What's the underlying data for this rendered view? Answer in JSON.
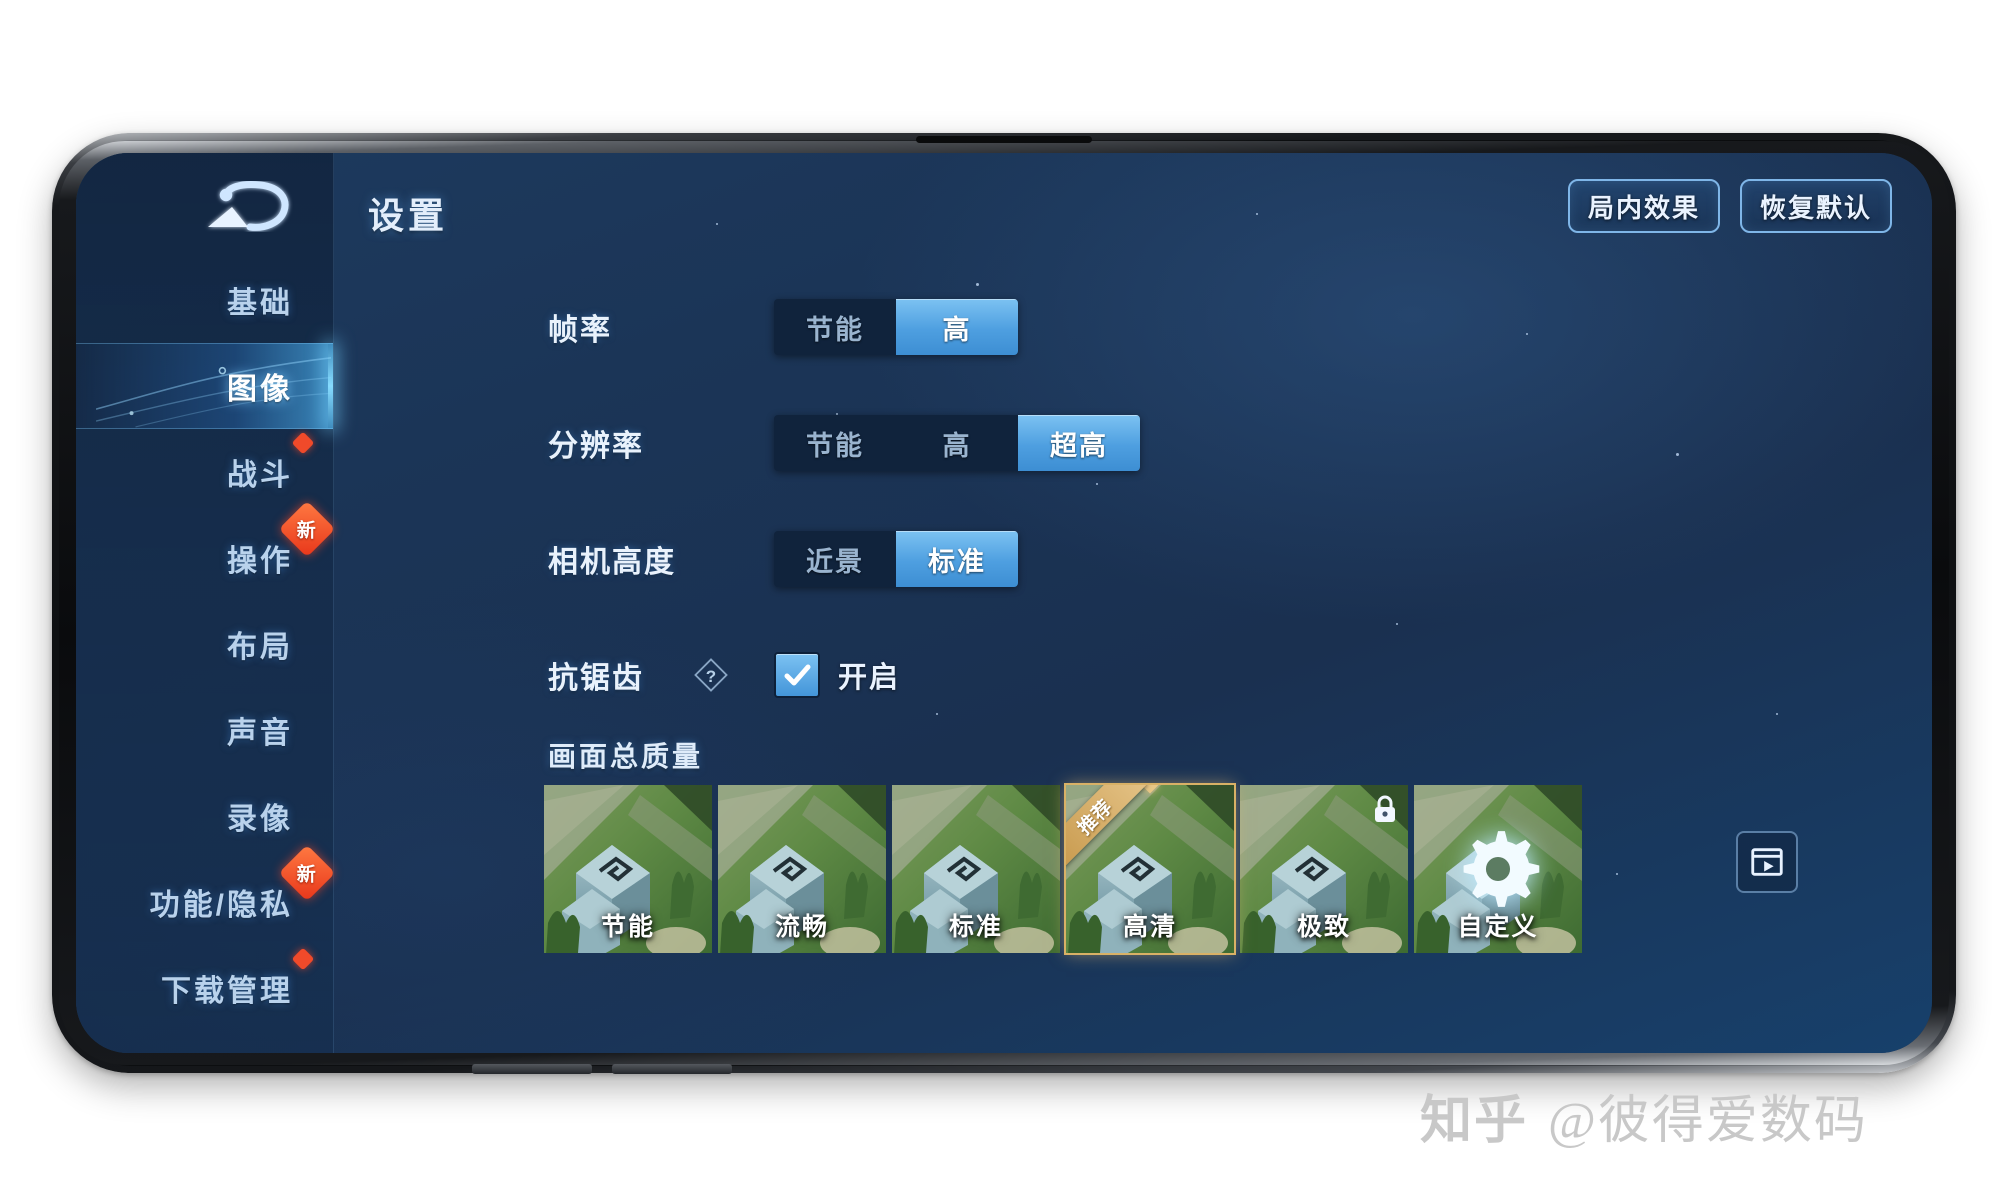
{
  "app": {
    "title": "设置",
    "back_icon": "back-arrow-icon"
  },
  "top_actions": [
    {
      "label": "局内效果",
      "name": "in-game-effects-button"
    },
    {
      "label": "恢复默认",
      "name": "restore-defaults-button"
    }
  ],
  "sidebar": {
    "items": [
      {
        "label": "基础",
        "active": false,
        "badge": ""
      },
      {
        "label": "图像",
        "active": true,
        "badge": ""
      },
      {
        "label": "战斗",
        "active": false,
        "badge": "dot"
      },
      {
        "label": "操作",
        "active": false,
        "badge": "new",
        "badge_text": "新"
      },
      {
        "label": "布局",
        "active": false,
        "badge": ""
      },
      {
        "label": "声音",
        "active": false,
        "badge": ""
      },
      {
        "label": "录像",
        "active": false,
        "badge": ""
      },
      {
        "label": "功能/隐私",
        "active": false,
        "badge": "new",
        "badge_text": "新"
      },
      {
        "label": "下载管理",
        "active": false,
        "badge": "dot"
      }
    ]
  },
  "settings": {
    "rows": [
      {
        "label": "帧率",
        "type": "segmented",
        "options": [
          "节能",
          "高"
        ],
        "selected": "高"
      },
      {
        "label": "分辨率",
        "type": "segmented",
        "options": [
          "节能",
          "高",
          "超高"
        ],
        "selected": "超高"
      },
      {
        "label": "相机高度",
        "type": "segmented",
        "options": [
          "近景",
          "标准"
        ],
        "selected": "标准"
      },
      {
        "label": "抗锯齿",
        "type": "checkbox",
        "help_icon": "question-diamond-icon",
        "checkbox_label": "开启",
        "checked": true
      }
    ]
  },
  "quality": {
    "title": "画面总质量",
    "presets": [
      {
        "label": "节能",
        "selected": false,
        "locked": false,
        "ribbon": "",
        "icon": ""
      },
      {
        "label": "流畅",
        "selected": false,
        "locked": false,
        "ribbon": "",
        "icon": ""
      },
      {
        "label": "标准",
        "selected": false,
        "locked": false,
        "ribbon": "",
        "icon": ""
      },
      {
        "label": "高清",
        "selected": true,
        "locked": false,
        "ribbon": "推荐",
        "icon": ""
      },
      {
        "label": "极致",
        "selected": false,
        "locked": true,
        "ribbon": "",
        "icon": "lock-icon"
      },
      {
        "label": "自定义",
        "selected": false,
        "locked": false,
        "ribbon": "",
        "icon": "gear-icon"
      }
    ],
    "preview_button": "video-preview-icon"
  },
  "watermark": {
    "site": "知乎",
    "author": "@彼得爱数码"
  },
  "colors": {
    "accent_blue": "#4e9fe0",
    "selected_gold": "#d9b166",
    "badge_red": "#f04a2a",
    "panel_dark": "#10233c",
    "screen_bg": "#1b3557"
  }
}
